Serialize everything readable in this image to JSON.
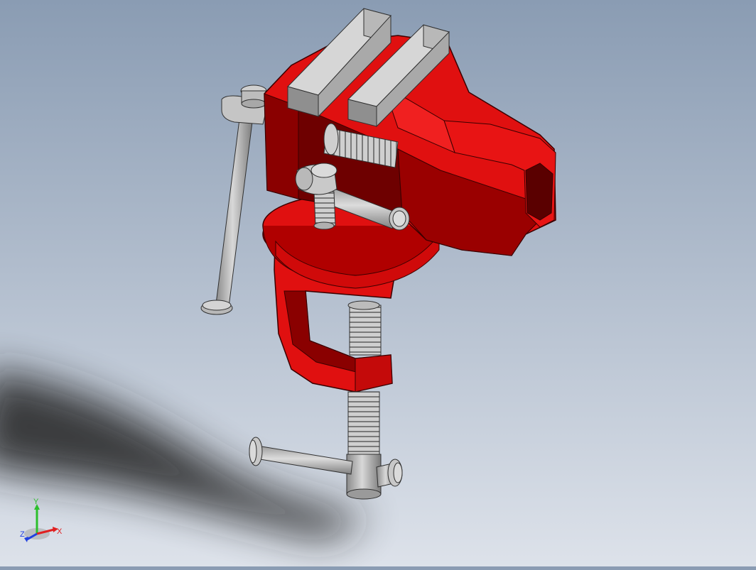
{
  "viewport": {
    "model_colors": {
      "body": "#e01010",
      "body_dark": "#8a0000",
      "body_edge": "#3a0000",
      "steel": "#c9c9c9",
      "steel_dark": "#7d7d7d",
      "steel_edge": "#303030"
    }
  },
  "triad": {
    "y_label": "Y",
    "x_label": "X",
    "z_label": "Z",
    "y_color": "#2cbf2c",
    "x_color": "#e02020",
    "z_color": "#2040e0"
  }
}
